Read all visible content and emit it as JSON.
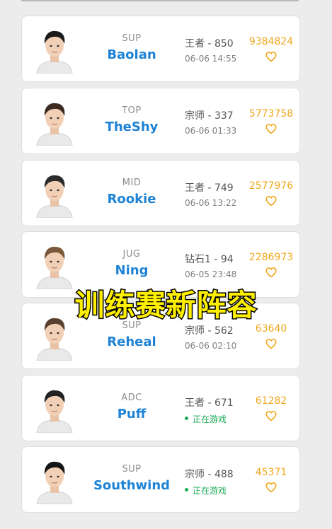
{
  "players": [
    {
      "role": "SUP",
      "name": "Baolan",
      "rank": "王者 - 850",
      "status": "06-06 14:55",
      "live": false,
      "count": "9384824"
    },
    {
      "role": "TOP",
      "name": "TheShy",
      "rank": "宗师 - 337",
      "status": "06-06 01:33",
      "live": false,
      "count": "5773758"
    },
    {
      "role": "MID",
      "name": "Rookie",
      "rank": "王者 - 749",
      "status": "06-06 13:22",
      "live": false,
      "count": "2577976"
    },
    {
      "role": "JUG",
      "name": "Ning",
      "rank": "钻石1 - 94",
      "status": "06-05 23:48",
      "live": false,
      "count": "2286973"
    },
    {
      "role": "SUP",
      "name": "Reheal",
      "rank": "宗师 - 562",
      "status": "06-06 02:10",
      "live": false,
      "count": "63640"
    },
    {
      "role": "ADC",
      "name": "Puff",
      "rank": "王者 - 671",
      "status": "正在游戏",
      "live": true,
      "count": "61282"
    },
    {
      "role": "SUP",
      "name": "Southwind",
      "rank": "宗师 - 488",
      "status": "正在游戏",
      "live": true,
      "count": "45371"
    }
  ],
  "overlay_caption": "训练赛新阵容",
  "icons": {
    "avatar": "player-portrait",
    "favorite": "heart-outline-icon",
    "live": "green-dot"
  },
  "colors": {
    "name": "#1e83d6",
    "count": "#f0a81c",
    "live": "#1aaa55"
  }
}
